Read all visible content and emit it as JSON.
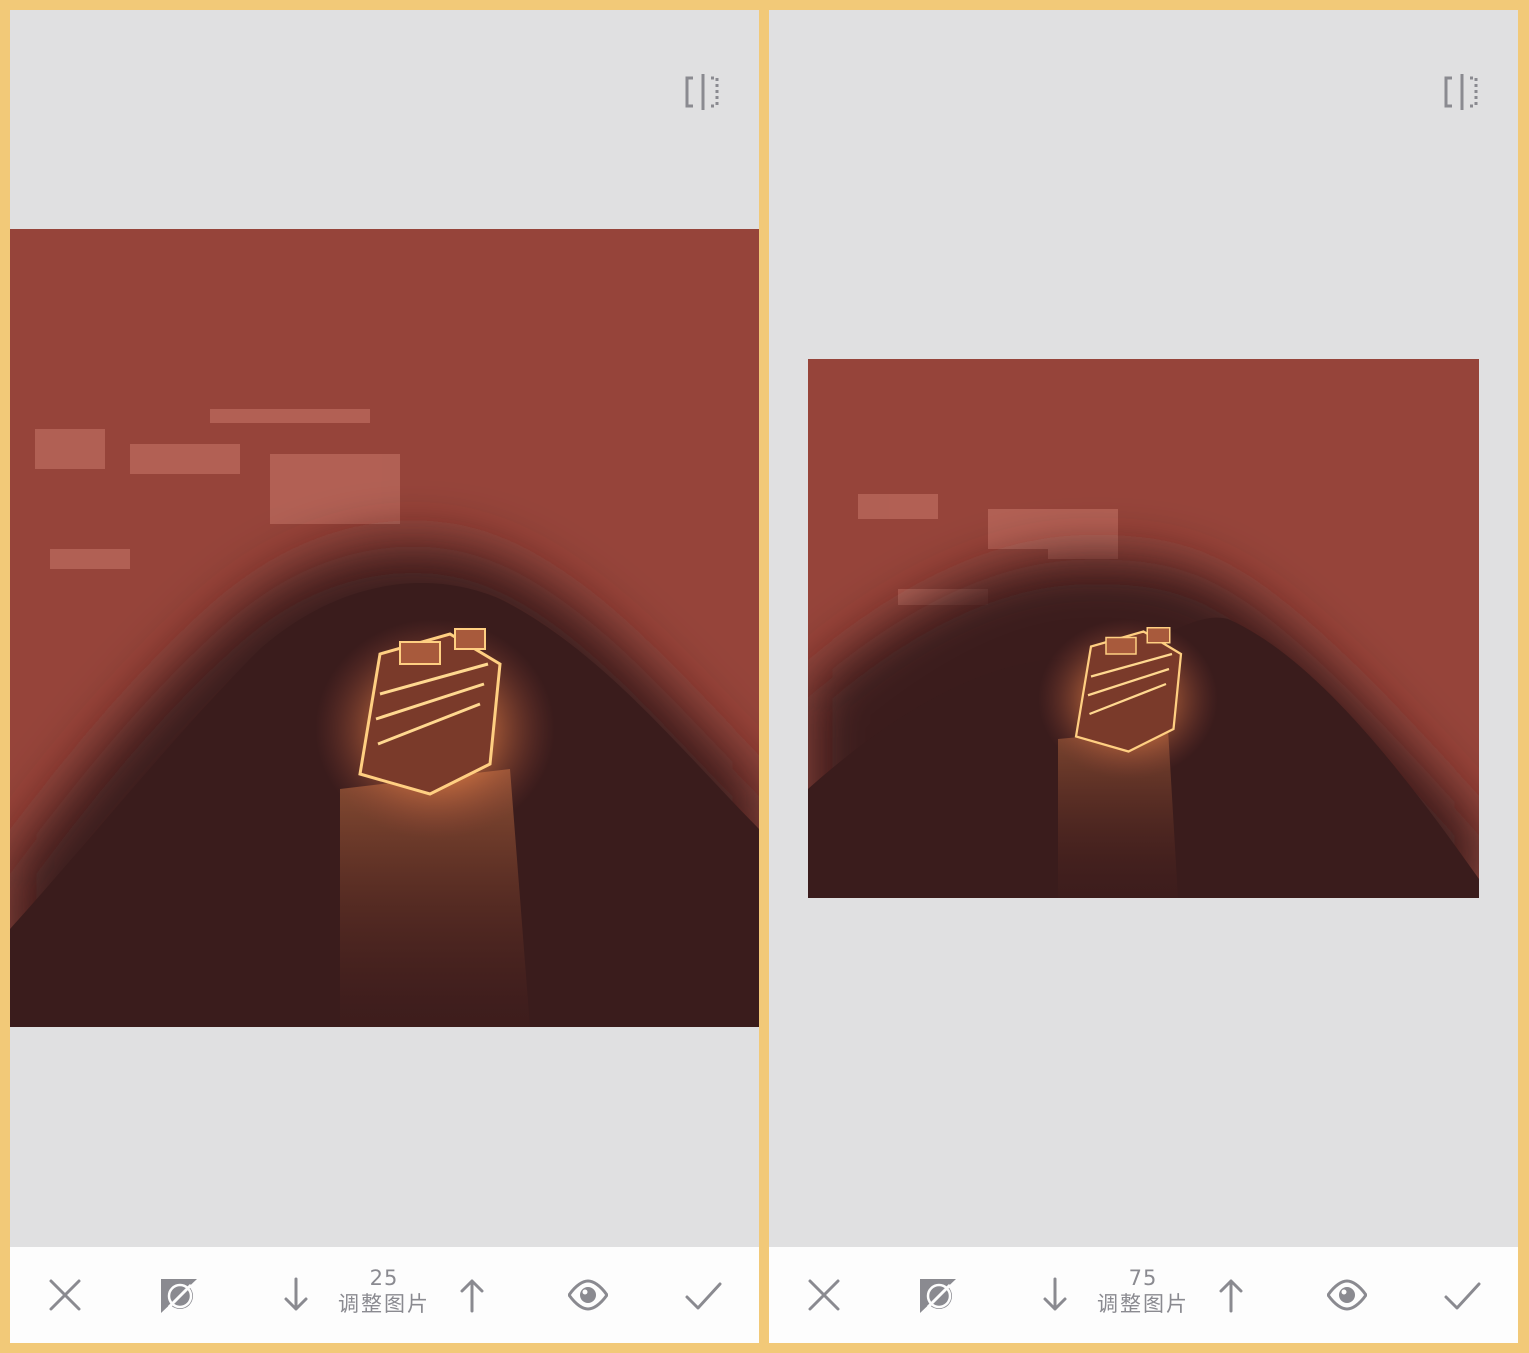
{
  "colors": {
    "frame": "#f2c978",
    "panel_bg": "#e0e0e1",
    "toolbar_bg": "#fdfdfd",
    "icon": "#8a8a90",
    "photo_red": "#96443a",
    "photo_dark": "#3a1c1c",
    "ship_glow": "#f0a860"
  },
  "panels": [
    {
      "compare_icon": "compare-split-icon",
      "toolbar": {
        "cancel_icon": "close-icon",
        "mask_icon": "brush-mask-icon",
        "decrease_icon": "arrow-down-icon",
        "increase_icon": "arrow-up-icon",
        "preview_icon": "eye-icon",
        "apply_icon": "checkmark-icon",
        "value": "25",
        "label": "调整图片"
      }
    },
    {
      "compare_icon": "compare-split-icon",
      "toolbar": {
        "cancel_icon": "close-icon",
        "mask_icon": "brush-mask-icon",
        "decrease_icon": "arrow-down-icon",
        "increase_icon": "arrow-up-icon",
        "preview_icon": "eye-icon",
        "apply_icon": "checkmark-icon",
        "value": "75",
        "label": "调整图片"
      }
    }
  ]
}
